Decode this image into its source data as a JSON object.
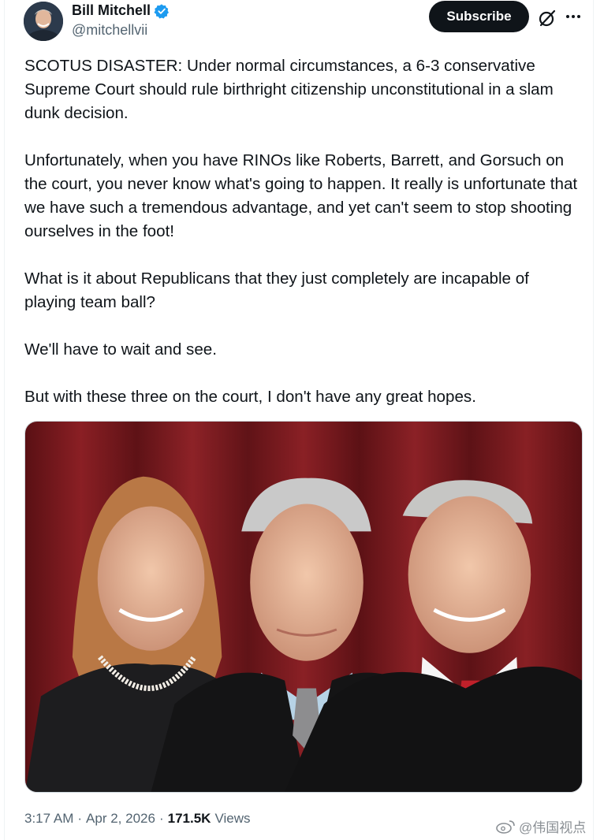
{
  "author": {
    "name": "Bill Mitchell",
    "handle": "@mitchellvii",
    "verified": true
  },
  "actions": {
    "subscribe_label": "Subscribe"
  },
  "tweet": {
    "paragraphs": [
      "SCOTUS DISASTER: Under normal circumstances, a 6-3 conservative Supreme Court should rule birthright citizenship unconstitutional in a slam dunk decision.",
      "Unfortunately, when you have RINOs like Roberts, Barrett, and Gorsuch on the court, you never know what's going to happen. It really is unfortunate that we have such a tremendous advantage, and yet can't seem to stop shooting ourselves in the foot!",
      "What is it about Republicans that they just completely are incapable of playing team ball?",
      "We'll have to wait and see.",
      "But with these three on the court, I don't have any great hopes."
    ]
  },
  "meta": {
    "time": "3:17 AM",
    "date": "Apr 2, 2026",
    "views_count": "171.5K",
    "views_label": "Views",
    "separator": "·"
  },
  "watermark": {
    "text": "@伟国视点"
  },
  "icons": {
    "verified": "verified-badge-icon",
    "grok": "grok-icon",
    "more": "more-icon"
  },
  "colors": {
    "accent": "#1d9bf0",
    "text": "#0f1419",
    "secondary": "#536471",
    "button": "#0f1419"
  }
}
